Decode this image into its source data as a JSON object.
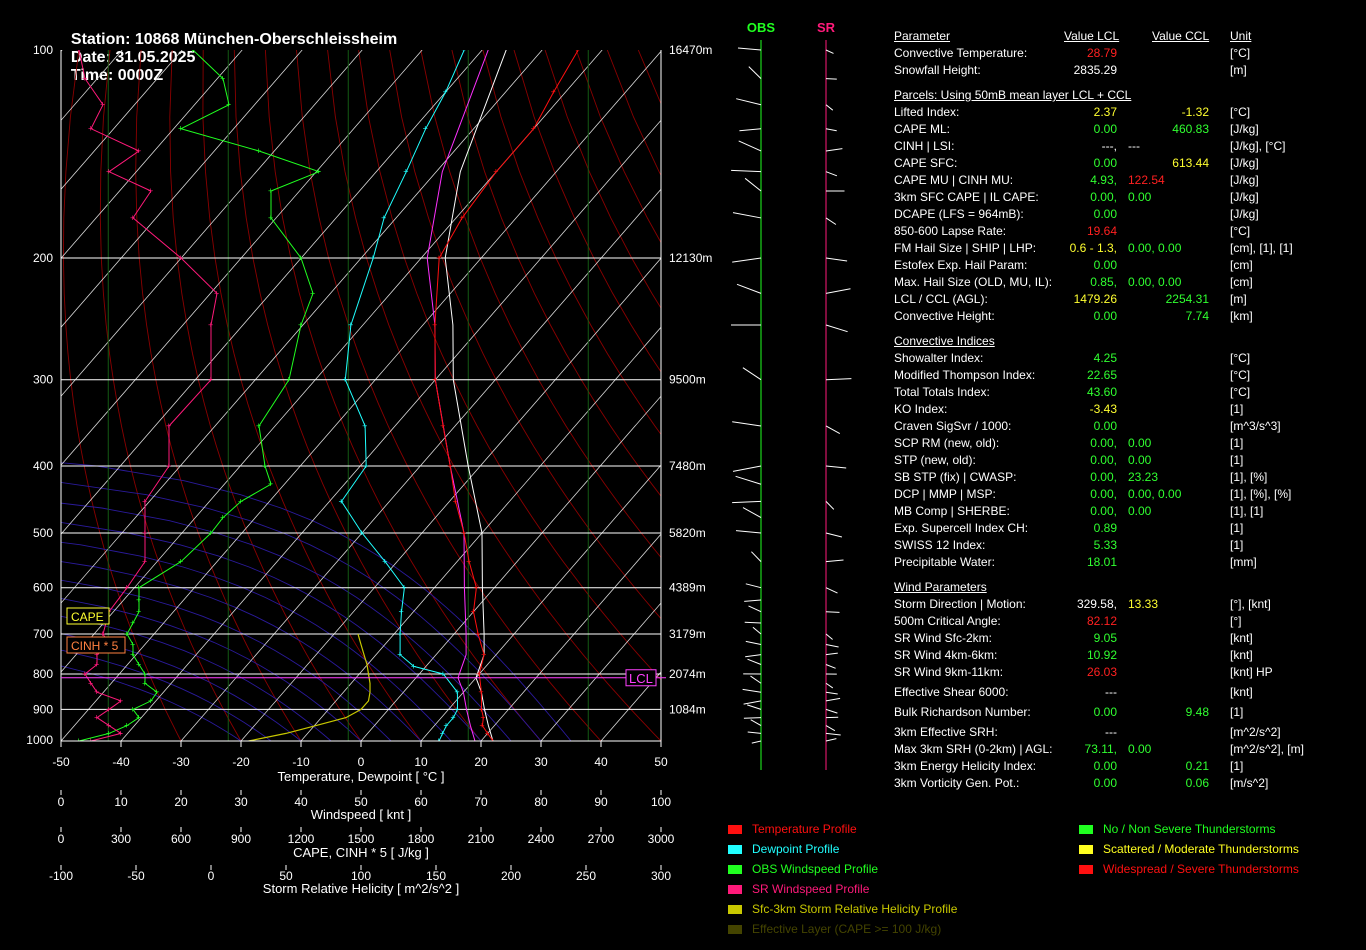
{
  "header": {
    "station": "Station: 10868 München-Oberschleissheim",
    "date": "Date: 31.05.2025",
    "time": "Time: 0000Z"
  },
  "chart_data": {
    "type": "skew-t",
    "pressure_levels": [
      "100",
      "200",
      "300",
      "400",
      "500",
      "600",
      "700",
      "800",
      "900",
      "1000"
    ],
    "pressure_values": [
      100,
      200,
      300,
      400,
      500,
      600,
      700,
      800,
      900,
      1000
    ],
    "height_labels": [
      {
        "p": 100,
        "label": "16470m"
      },
      {
        "p": 200,
        "label": "12130m"
      },
      {
        "p": 300,
        "label": "9500m"
      },
      {
        "p": 400,
        "label": "7480m"
      },
      {
        "p": 500,
        "label": "5820m"
      },
      {
        "p": 600,
        "label": "4389m"
      },
      {
        "p": 700,
        "label": "3179m"
      },
      {
        "p": 800,
        "label": "2074m"
      },
      {
        "p": 900,
        "label": "1084m"
      }
    ],
    "temp_ticks": [
      "-50",
      "-40",
      "-30",
      "-20",
      "-10",
      "0",
      "10",
      "20",
      "30",
      "40",
      "50"
    ],
    "xlabel": "Temperature, Dewpoint  [ °C ]",
    "windspeed_axis": {
      "ticks": [
        "0",
        "10",
        "20",
        "30",
        "40",
        "50",
        "60",
        "70",
        "80",
        "90",
        "100"
      ],
      "label": "Windspeed  [ knt ]"
    },
    "cape_axis": {
      "ticks": [
        "0",
        "300",
        "600",
        "900",
        "1200",
        "1500",
        "1800",
        "2100",
        "2400",
        "2700",
        "3000"
      ],
      "label": "CAPE, CINH * 5  [ J/kg ]"
    },
    "srh_axis": {
      "ticks": [
        "-100",
        "-50",
        "0",
        "50",
        "100",
        "150",
        "200",
        "250",
        "300"
      ],
      "label": "Storm Relative Helicity  [ m^2/s^2 ]"
    },
    "box_cape": "CAPE",
    "box_cinh": "CINH * 5",
    "box_lcl": "LCL",
    "lcl_pressure": 810,
    "temperature": [
      [
        1000,
        22
      ],
      [
        975,
        20
      ],
      [
        950,
        18
      ],
      [
        925,
        17
      ],
      [
        900,
        15.5
      ],
      [
        850,
        13
      ],
      [
        800,
        10
      ],
      [
        750,
        8
      ],
      [
        700,
        4
      ],
      [
        650,
        0
      ],
      [
        600,
        -3
      ],
      [
        550,
        -8
      ],
      [
        500,
        -13
      ],
      [
        450,
        -19
      ],
      [
        400,
        -25
      ],
      [
        350,
        -32
      ],
      [
        300,
        -40
      ],
      [
        250,
        -48
      ],
      [
        200,
        -57
      ],
      [
        175,
        -59
      ],
      [
        150,
        -60
      ],
      [
        130,
        -60
      ],
      [
        115,
        -62
      ],
      [
        100,
        -64
      ]
    ],
    "dewpoint": [
      [
        1000,
        13
      ],
      [
        975,
        12.5
      ],
      [
        950,
        12
      ],
      [
        925,
        12
      ],
      [
        900,
        11.5
      ],
      [
        850,
        9
      ],
      [
        800,
        4
      ],
      [
        780,
        -2
      ],
      [
        750,
        -6
      ],
      [
        700,
        -9
      ],
      [
        650,
        -12
      ],
      [
        600,
        -15
      ],
      [
        550,
        -22
      ],
      [
        500,
        -30
      ],
      [
        450,
        -38
      ],
      [
        400,
        -39
      ],
      [
        350,
        -45
      ],
      [
        300,
        -55
      ],
      [
        250,
        -62
      ],
      [
        200,
        -68
      ],
      [
        175,
        -72
      ],
      [
        150,
        -75
      ],
      [
        130,
        -78
      ],
      [
        115,
        -80
      ],
      [
        100,
        -83
      ]
    ],
    "parcel": [
      [
        1000,
        22
      ],
      [
        950,
        19
      ],
      [
        900,
        16
      ],
      [
        850,
        13
      ],
      [
        810,
        10
      ],
      [
        750,
        8
      ],
      [
        700,
        5
      ],
      [
        600,
        -2
      ],
      [
        500,
        -10
      ],
      [
        400,
        -22
      ],
      [
        300,
        -37
      ],
      [
        250,
        -45
      ],
      [
        200,
        -56
      ],
      [
        150,
        -66
      ],
      [
        100,
        -76
      ]
    ],
    "obs_wind_profile": [
      [
        1000,
        3
      ],
      [
        975,
        8
      ],
      [
        950,
        11
      ],
      [
        925,
        13
      ],
      [
        900,
        12
      ],
      [
        875,
        15
      ],
      [
        850,
        16
      ],
      [
        825,
        14
      ],
      [
        800,
        14
      ],
      [
        775,
        13
      ],
      [
        750,
        12
      ],
      [
        725,
        12
      ],
      [
        700,
        11
      ],
      [
        675,
        12
      ],
      [
        650,
        13
      ],
      [
        625,
        13
      ],
      [
        600,
        13
      ],
      [
        550,
        20
      ],
      [
        500,
        25
      ],
      [
        475,
        27
      ],
      [
        450,
        30
      ],
      [
        425,
        35
      ],
      [
        400,
        34
      ],
      [
        350,
        33
      ],
      [
        300,
        38
      ],
      [
        250,
        40
      ],
      [
        225,
        42
      ],
      [
        200,
        40
      ],
      [
        175,
        35
      ],
      [
        160,
        35
      ],
      [
        150,
        43
      ],
      [
        140,
        33
      ],
      [
        130,
        20
      ],
      [
        120,
        28
      ],
      [
        110,
        27
      ],
      [
        100,
        22
      ]
    ],
    "sr_wind_profile": [
      [
        1000,
        5
      ],
      [
        975,
        10
      ],
      [
        950,
        8
      ],
      [
        925,
        6
      ],
      [
        900,
        8
      ],
      [
        875,
        10
      ],
      [
        850,
        6
      ],
      [
        825,
        5
      ],
      [
        800,
        4
      ],
      [
        775,
        6
      ],
      [
        750,
        6
      ],
      [
        725,
        8
      ],
      [
        700,
        7
      ],
      [
        650,
        8
      ],
      [
        600,
        11
      ],
      [
        550,
        14
      ],
      [
        500,
        14
      ],
      [
        450,
        14
      ],
      [
        400,
        18
      ],
      [
        350,
        18
      ],
      [
        300,
        25
      ],
      [
        250,
        25
      ],
      [
        225,
        26
      ],
      [
        200,
        20
      ],
      [
        175,
        12
      ],
      [
        160,
        15
      ],
      [
        150,
        8
      ],
      [
        140,
        13
      ],
      [
        130,
        5
      ],
      [
        120,
        7
      ],
      [
        110,
        4
      ],
      [
        100,
        3
      ]
    ],
    "srh_profile": [
      [
        1000,
        25
      ],
      [
        975,
        50
      ],
      [
        950,
        70
      ],
      [
        925,
        90
      ],
      [
        900,
        100
      ],
      [
        875,
        105
      ],
      [
        850,
        106
      ],
      [
        825,
        106
      ],
      [
        800,
        105
      ],
      [
        775,
        104
      ],
      [
        750,
        102
      ],
      [
        725,
        100
      ],
      [
        700,
        98
      ]
    ]
  },
  "obs_label": "OBS",
  "sr_label": "SR",
  "table": {
    "head": {
      "param": "Parameter",
      "lcl": "Value LCL",
      "ccl": "Value CCL",
      "unit": "Unit"
    },
    "rows": [
      {
        "type": "row",
        "label": "Convective Temperature:",
        "v1": "28.79",
        "c1": "#ff2020",
        "v2": "",
        "c2": "",
        "unit": "[°C]"
      },
      {
        "type": "row",
        "label": "Snowfall Height:",
        "v1": "2835.29",
        "c1": "#ffffff",
        "v2": "",
        "c2": "",
        "unit": "[m]"
      },
      {
        "type": "gap"
      },
      {
        "type": "sec",
        "label": "Parcels: Using 50mB mean layer LCL + CCL"
      },
      {
        "type": "row",
        "label": "Lifted Index:",
        "v1": "2.37",
        "c1": "#ffff30",
        "v2": "-1.32",
        "c2": "#ffff30",
        "unit": "[°C]"
      },
      {
        "type": "row",
        "label": "CAPE ML:",
        "v1": "0.00",
        "c1": "#30ff30",
        "v2": "460.83",
        "c2": "#30ff30",
        "unit": "[J/kg]"
      },
      {
        "type": "row",
        "label": "CINH | LSI:",
        "v1": "---,",
        "c1": "#ffffff",
        "v2": "---",
        "c2": "#ffffff",
        "v2pos": "mid",
        "unit": "[J/kg], [°C]"
      },
      {
        "type": "row",
        "label": "CAPE SFC:",
        "v1": "0.00",
        "c1": "#30ff30",
        "v2": "613.44",
        "c2": "#ffff30",
        "unit": "[J/kg]"
      },
      {
        "type": "row",
        "label": "CAPE MU | CINH MU:",
        "v1": "4.93,",
        "c1": "#30ff30",
        "v2": "122.54",
        "c2": "#ff2020",
        "v2pos": "mid",
        "unit": "[J/kg]"
      },
      {
        "type": "row",
        "label": "3km SFC CAPE | IL CAPE:",
        "v1": "0.00,",
        "c1": "#30ff30",
        "v2": "0.00",
        "c2": "#30ff30",
        "v2pos": "mid",
        "unit": "[J/kg]"
      },
      {
        "type": "row",
        "label": "DCAPE (LFS = 964mB):",
        "v1": "0.00",
        "c1": "#30ff30",
        "v2": "",
        "c2": "",
        "unit": "[J/kg]"
      },
      {
        "type": "row",
        "label": "850-600 Lapse Rate:",
        "v1": "19.64",
        "c1": "#ff2020",
        "v2": "",
        "c2": "",
        "unit": "[°C]"
      },
      {
        "type": "row",
        "label": "FM Hail Size | SHIP | LHP:",
        "v1": "0.6 - 1.3,",
        "c1": "#ffff30",
        "v2": "0.00,  0.00",
        "c2": "#30ff30",
        "v2pos": "mid",
        "unit": "[cm], [1], [1]"
      },
      {
        "type": "row",
        "label": "Estofex Exp. Hail Param:",
        "v1": "0.00",
        "c1": "#30ff30",
        "v2": "",
        "c2": "",
        "unit": "[cm]"
      },
      {
        "type": "row",
        "label": "Max. Hail Size (OLD, MU, IL):",
        "v1": "0.85,",
        "c1": "#30ff30",
        "v2": "0.00,  0.00",
        "c2": "#30ff30",
        "v2pos": "mid",
        "unit": "[cm]"
      },
      {
        "type": "row",
        "label": "LCL / CCL (AGL):",
        "v1": "1479.26",
        "c1": "#ffff30",
        "v2": "2254.31",
        "c2": "#30ff30",
        "unit": "[m]"
      },
      {
        "type": "row",
        "label": "Convective Height:",
        "v1": "0.00",
        "c1": "#30ff30",
        "v2": "7.74",
        "c2": "#30ff30",
        "unit": "[km]"
      },
      {
        "type": "gap"
      },
      {
        "type": "sec",
        "label": "Convective Indices"
      },
      {
        "type": "row",
        "label": "Showalter Index:",
        "v1": "4.25",
        "c1": "#30ff30",
        "v2": "",
        "c2": "",
        "unit": "[°C]"
      },
      {
        "type": "row",
        "label": "Modified Thompson Index:",
        "v1": "22.65",
        "c1": "#30ff30",
        "v2": "",
        "c2": "",
        "unit": "[°C]"
      },
      {
        "type": "row",
        "label": "Total Totals Index:",
        "v1": "43.60",
        "c1": "#30ff30",
        "v2": "",
        "c2": "",
        "unit": "[°C]"
      },
      {
        "type": "row",
        "label": "KO Index:",
        "v1": "-3.43",
        "c1": "#ffff30",
        "v2": "",
        "c2": "",
        "unit": "[1]"
      },
      {
        "type": "row",
        "label": "Craven SigSvr / 1000:",
        "v1": "0.00",
        "c1": "#30ff30",
        "v2": "",
        "c2": "",
        "unit": "[m^3/s^3]"
      },
      {
        "type": "row",
        "label": "SCP RM (new, old):",
        "v1": "0.00,",
        "c1": "#30ff30",
        "v2": "0.00",
        "c2": "#30ff30",
        "v2pos": "mid",
        "unit": "[1]"
      },
      {
        "type": "row",
        "label": "STP (new, old):",
        "v1": "0.00,",
        "c1": "#30ff30",
        "v2": "0.00",
        "c2": "#30ff30",
        "v2pos": "mid",
        "unit": "[1]"
      },
      {
        "type": "row",
        "label": "SB STP (fix) | CWASP:",
        "v1": "0.00,",
        "c1": "#30ff30",
        "v2": "23.23",
        "c2": "#30ff30",
        "v2pos": "mid",
        "unit": "[1], [%]"
      },
      {
        "type": "row",
        "label": "DCP | MMP | MSP:",
        "v1": "0.00,",
        "c1": "#30ff30",
        "v2": "0.00,  0.00",
        "c2": "#30ff30",
        "v2pos": "mid",
        "unit": "[1], [%], [%]"
      },
      {
        "type": "row",
        "label": "MB Comp | SHERBE:",
        "v1": "0.00,",
        "c1": "#30ff30",
        "v2": "0.00",
        "c2": "#30ff30",
        "v2pos": "mid",
        "unit": "[1], [1]"
      },
      {
        "type": "row",
        "label": "Exp. Supercell Index CH:",
        "v1": "0.89",
        "c1": "#30ff30",
        "v2": "",
        "c2": "",
        "unit": "[1]"
      },
      {
        "type": "row",
        "label": "SWISS 12 Index:",
        "v1": "5.33",
        "c1": "#30ff30",
        "v2": "",
        "c2": "",
        "unit": "[1]"
      },
      {
        "type": "row",
        "label": "Precipitable Water:",
        "v1": "18.01",
        "c1": "#30ff30",
        "v2": "",
        "c2": "",
        "unit": "[mm]"
      },
      {
        "type": "gap"
      },
      {
        "type": "sec",
        "label": "Wind Parameters"
      },
      {
        "type": "row",
        "label": "Storm Direction | Motion:",
        "v1": "329.58,",
        "c1": "#ffffff",
        "v2": "13.33",
        "c2": "#ffff30",
        "v2pos": "mid",
        "unit": "[°], [knt]"
      },
      {
        "type": "row",
        "label": "500m Critical Angle:",
        "v1": "82.12",
        "c1": "#ff2020",
        "v2": "",
        "c2": "",
        "unit": "[°]"
      },
      {
        "type": "row",
        "label": "SR Wind Sfc-2km:",
        "v1": "9.05",
        "c1": "#30ff30",
        "v2": "",
        "c2": "",
        "unit": "[knt]"
      },
      {
        "type": "row",
        "label": "SR Wind 4km-6km:",
        "v1": "10.92",
        "c1": "#30ff30",
        "v2": "",
        "c2": "",
        "unit": "[knt]"
      },
      {
        "type": "row",
        "label": "SR Wind 9km-11km:",
        "v1": "26.03",
        "c1": "#ff2020",
        "v2": "",
        "c2": "",
        "unit": "[knt] HP"
      },
      {
        "type": "gap3"
      },
      {
        "type": "row",
        "label": "Effective Shear 6000:",
        "v1": "---",
        "c1": "#ffffff",
        "v2": "",
        "c2": "",
        "unit": "[knt]"
      },
      {
        "type": "gap3"
      },
      {
        "type": "row",
        "label": "Bulk Richardson Number:",
        "v1": "0.00",
        "c1": "#30ff30",
        "v2": "9.48",
        "c2": "#30ff30",
        "unit": "[1]"
      },
      {
        "type": "gap3"
      },
      {
        "type": "row",
        "label": "3km Effective SRH:",
        "v1": "---",
        "c1": "#ffffff",
        "v2": "",
        "c2": "",
        "unit": "[m^2/s^2]"
      },
      {
        "type": "row",
        "label": "Max 3km SRH (0-2km) | AGL:",
        "v1": "73.11,",
        "c1": "#30ff30",
        "v2": "0.00",
        "c2": "#30ff30",
        "v2pos": "mid",
        "unit": "[m^2/s^2], [m]"
      },
      {
        "type": "row",
        "label": "3km Energy Helicity Index:",
        "v1": "0.00",
        "c1": "#30ff30",
        "v2": "0.21",
        "c2": "#30ff30",
        "unit": "[1]"
      },
      {
        "type": "row",
        "label": "3km Vorticity Gen. Pot.:",
        "v1": "0.00",
        "c1": "#30ff30",
        "v2": "0.06",
        "c2": "#30ff30",
        "unit": "[m/s^2]"
      }
    ]
  },
  "legend": {
    "left": [
      {
        "label": "Temperature Profile",
        "color": "#ff1010"
      },
      {
        "label": "Dewpoint Profile",
        "color": "#20ffff"
      },
      {
        "label": "OBS Windspeed Profile",
        "color": "#20ff20"
      },
      {
        "label": "SR Windspeed Profile",
        "color": "#ff1a7a"
      },
      {
        "label": "Sfc-3km Storm Relative Helicity Profile",
        "color": "#c8c800"
      },
      {
        "label": "Effective Layer (CAPE >= 100 J/kg)",
        "color": "#444400"
      }
    ],
    "right": [
      {
        "label": "No / Non Severe Thunderstorms",
        "color": "#20ff20"
      },
      {
        "label": "Scattered / Moderate Thunderstorms",
        "color": "#ffff20"
      },
      {
        "label": "Widespread / Severe Thunderstorms",
        "color": "#ff1010"
      }
    ]
  },
  "colors": {
    "temp": "#ff1010",
    "dew": "#20ffff",
    "obs": "#20ff20",
    "sr": "#ff1a7a",
    "srh": "#c8c800",
    "parcel": "#ffffff",
    "env": "#ff30ff"
  }
}
